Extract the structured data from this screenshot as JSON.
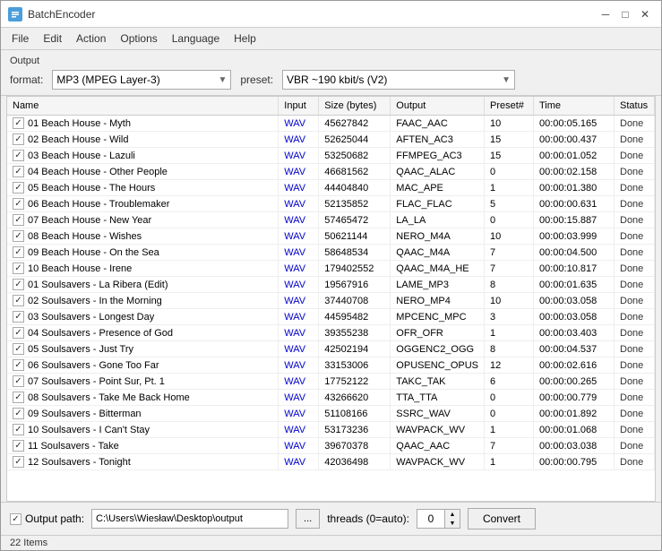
{
  "window": {
    "title": "BatchEncoder",
    "icon": "BE"
  },
  "titleControls": {
    "minimize": "─",
    "maximize": "□",
    "close": "✕"
  },
  "menu": {
    "items": [
      "File",
      "Edit",
      "Action",
      "Options",
      "Language",
      "Help"
    ]
  },
  "output": {
    "label": "Output",
    "format_label": "format:",
    "format_value": "MP3 (MPEG Layer-3)",
    "preset_label": "preset:",
    "preset_value": "VBR ~190 kbit/s (V2)"
  },
  "table": {
    "columns": [
      "Name",
      "Input",
      "Size (bytes)",
      "Output",
      "Preset#",
      "Time",
      "Status"
    ],
    "rows": [
      {
        "name": "01 Beach House - Myth",
        "input": "WAV",
        "size": "45627842",
        "output": "FAAC_AAC",
        "preset": "10",
        "time": "00:00:05.165",
        "status": "Done"
      },
      {
        "name": "02 Beach House - Wild",
        "input": "WAV",
        "size": "52625044",
        "output": "AFTEN_AC3",
        "preset": "15",
        "time": "00:00:00.437",
        "status": "Done"
      },
      {
        "name": "03 Beach House - Lazuli",
        "input": "WAV",
        "size": "53250682",
        "output": "FFMPEG_AC3",
        "preset": "15",
        "time": "00:00:01.052",
        "status": "Done"
      },
      {
        "name": "04 Beach House - Other People",
        "input": "WAV",
        "size": "46681562",
        "output": "QAAC_ALAC",
        "preset": "0",
        "time": "00:00:02.158",
        "status": "Done"
      },
      {
        "name": "05 Beach House - The Hours",
        "input": "WAV",
        "size": "44404840",
        "output": "MAC_APE",
        "preset": "1",
        "time": "00:00:01.380",
        "status": "Done"
      },
      {
        "name": "06 Beach House - Troublemaker",
        "input": "WAV",
        "size": "52135852",
        "output": "FLAC_FLAC",
        "preset": "5",
        "time": "00:00:00.631",
        "status": "Done"
      },
      {
        "name": "07 Beach House - New Year",
        "input": "WAV",
        "size": "57465472",
        "output": "LA_LA",
        "preset": "0",
        "time": "00:00:15.887",
        "status": "Done"
      },
      {
        "name": "08 Beach House - Wishes",
        "input": "WAV",
        "size": "50621144",
        "output": "NERO_M4A",
        "preset": "10",
        "time": "00:00:03.999",
        "status": "Done"
      },
      {
        "name": "09 Beach House - On the Sea",
        "input": "WAV",
        "size": "58648534",
        "output": "QAAC_M4A",
        "preset": "7",
        "time": "00:00:04.500",
        "status": "Done"
      },
      {
        "name": "10 Beach House - Irene",
        "input": "WAV",
        "size": "179402552",
        "output": "QAAC_M4A_HE",
        "preset": "7",
        "time": "00:00:10.817",
        "status": "Done"
      },
      {
        "name": "01 Soulsavers - La Ribera (Edit)",
        "input": "WAV",
        "size": "19567916",
        "output": "LAME_MP3",
        "preset": "8",
        "time": "00:00:01.635",
        "status": "Done"
      },
      {
        "name": "02 Soulsavers - In the Morning",
        "input": "WAV",
        "size": "37440708",
        "output": "NERO_MP4",
        "preset": "10",
        "time": "00:00:03.058",
        "status": "Done"
      },
      {
        "name": "03 Soulsavers - Longest Day",
        "input": "WAV",
        "size": "44595482",
        "output": "MPCENC_MPC",
        "preset": "3",
        "time": "00:00:03.058",
        "status": "Done"
      },
      {
        "name": "04 Soulsavers - Presence of God",
        "input": "WAV",
        "size": "39355238",
        "output": "OFR_OFR",
        "preset": "1",
        "time": "00:00:03.403",
        "status": "Done"
      },
      {
        "name": "05 Soulsavers - Just Try",
        "input": "WAV",
        "size": "42502194",
        "output": "OGGENC2_OGG",
        "preset": "8",
        "time": "00:00:04.537",
        "status": "Done"
      },
      {
        "name": "06 Soulsavers - Gone Too Far",
        "input": "WAV",
        "size": "33153006",
        "output": "OPUSENC_OPUS",
        "preset": "12",
        "time": "00:00:02.616",
        "status": "Done"
      },
      {
        "name": "07 Soulsavers - Point Sur, Pt. 1",
        "input": "WAV",
        "size": "17752122",
        "output": "TAKC_TAK",
        "preset": "6",
        "time": "00:00:00.265",
        "status": "Done"
      },
      {
        "name": "08 Soulsavers - Take Me Back Home",
        "input": "WAV",
        "size": "43266620",
        "output": "TTA_TTA",
        "preset": "0",
        "time": "00:00:00.779",
        "status": "Done"
      },
      {
        "name": "09 Soulsavers - Bitterman",
        "input": "WAV",
        "size": "51108166",
        "output": "SSRC_WAV",
        "preset": "0",
        "time": "00:00:01.892",
        "status": "Done"
      },
      {
        "name": "10 Soulsavers - I Can't Stay",
        "input": "WAV",
        "size": "53173236",
        "output": "WAVPACK_WV",
        "preset": "1",
        "time": "00:00:01.068",
        "status": "Done"
      },
      {
        "name": "11 Soulsavers - Take",
        "input": "WAV",
        "size": "39670378",
        "output": "QAAC_AAC",
        "preset": "7",
        "time": "00:00:03.038",
        "status": "Done"
      },
      {
        "name": "12 Soulsavers - Tonight",
        "input": "WAV",
        "size": "42036498",
        "output": "WAVPACK_WV",
        "preset": "1",
        "time": "00:00:00.795",
        "status": "Done"
      }
    ]
  },
  "statusBar": {
    "output_path_label": "Output path:",
    "path_value": "C:\\Users\\Wiesław\\Desktop\\output",
    "browse_label": "...",
    "threads_label": "threads (0=auto):",
    "threads_value": "0",
    "convert_label": "Convert"
  },
  "footer": {
    "items_count": "22 Items"
  }
}
